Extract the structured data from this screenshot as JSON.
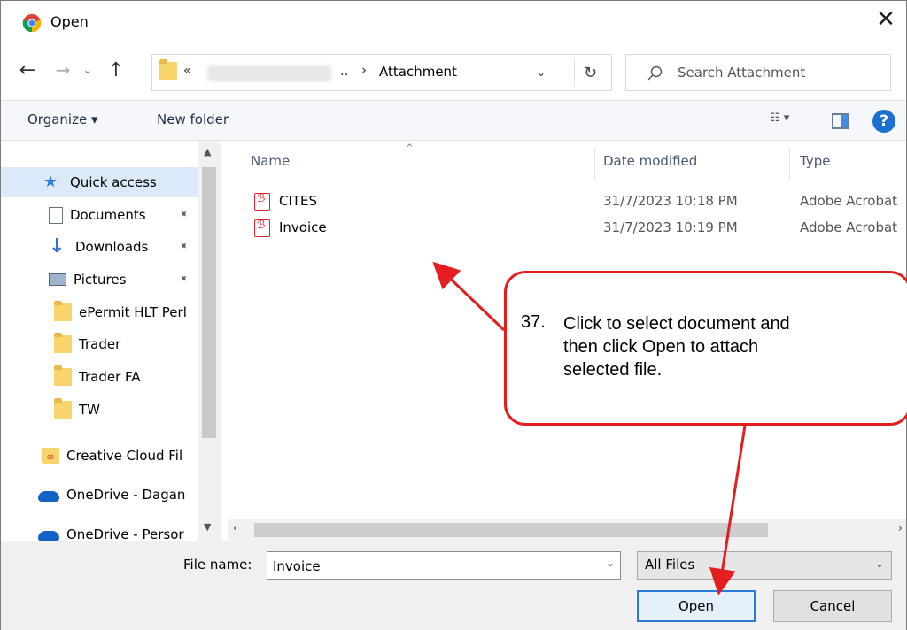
{
  "window": {
    "title": "Open",
    "close_glyph": "✕"
  },
  "nav": {
    "back_glyph": "←",
    "forward_glyph": "→",
    "recent_glyph": "⌄",
    "up_glyph": "↑"
  },
  "address": {
    "overflow": "«",
    "ellipsis": "..",
    "separator": "›",
    "current_folder": "Attachment",
    "dropdown_glyph": "⌄",
    "refresh_glyph": "↻"
  },
  "search": {
    "placeholder": "Search Attachment"
  },
  "commandbar": {
    "organize_label": "Organize ▾",
    "new_folder_label": "New folder",
    "views_label": "☷ ▾",
    "help_glyph": "?"
  },
  "sidebar": {
    "items": [
      {
        "label": "Quick access",
        "icon": "star-icon",
        "pinned": false
      },
      {
        "label": "Documents",
        "icon": "documents-icon",
        "pinned": true
      },
      {
        "label": "Downloads",
        "icon": "download-arrow-icon",
        "pinned": true
      },
      {
        "label": "Pictures",
        "icon": "pictures-icon",
        "pinned": true
      },
      {
        "label": "ePermit HLT Perl",
        "icon": "folder-icon",
        "pinned": false
      },
      {
        "label": "Trader",
        "icon": "folder-icon",
        "pinned": false
      },
      {
        "label": "Trader FA",
        "icon": "folder-icon",
        "pinned": false
      },
      {
        "label": "TW",
        "icon": "folder-icon",
        "pinned": false
      },
      {
        "label": "Creative Cloud Fil",
        "icon": "creative-cloud-icon",
        "pinned": false
      },
      {
        "label": "OneDrive - Dagan",
        "icon": "cloud-icon",
        "pinned": false
      },
      {
        "label": "OneDrive - Persor",
        "icon": "cloud-icon",
        "pinned": false
      }
    ],
    "pin_glyph": "📌"
  },
  "filelist": {
    "columns": [
      "Name",
      "Date modified",
      "Type"
    ],
    "rows": [
      {
        "name": "CITES",
        "date": "31/7/2023 10:18 PM",
        "type": "Adobe Acrobat"
      },
      {
        "name": "Invoice",
        "date": "31/7/2023 10:19 PM",
        "type": "Adobe Acrobat"
      }
    ]
  },
  "footer": {
    "filename_label": "File name:",
    "filename_value": "Invoice",
    "filetype_value": "All Files",
    "open_label": "Open",
    "cancel_label": "Cancel"
  },
  "annotation": {
    "number": "37.",
    "text": "Click to select document and then click Open to attach selected file.",
    "color": "#e41e1e"
  }
}
